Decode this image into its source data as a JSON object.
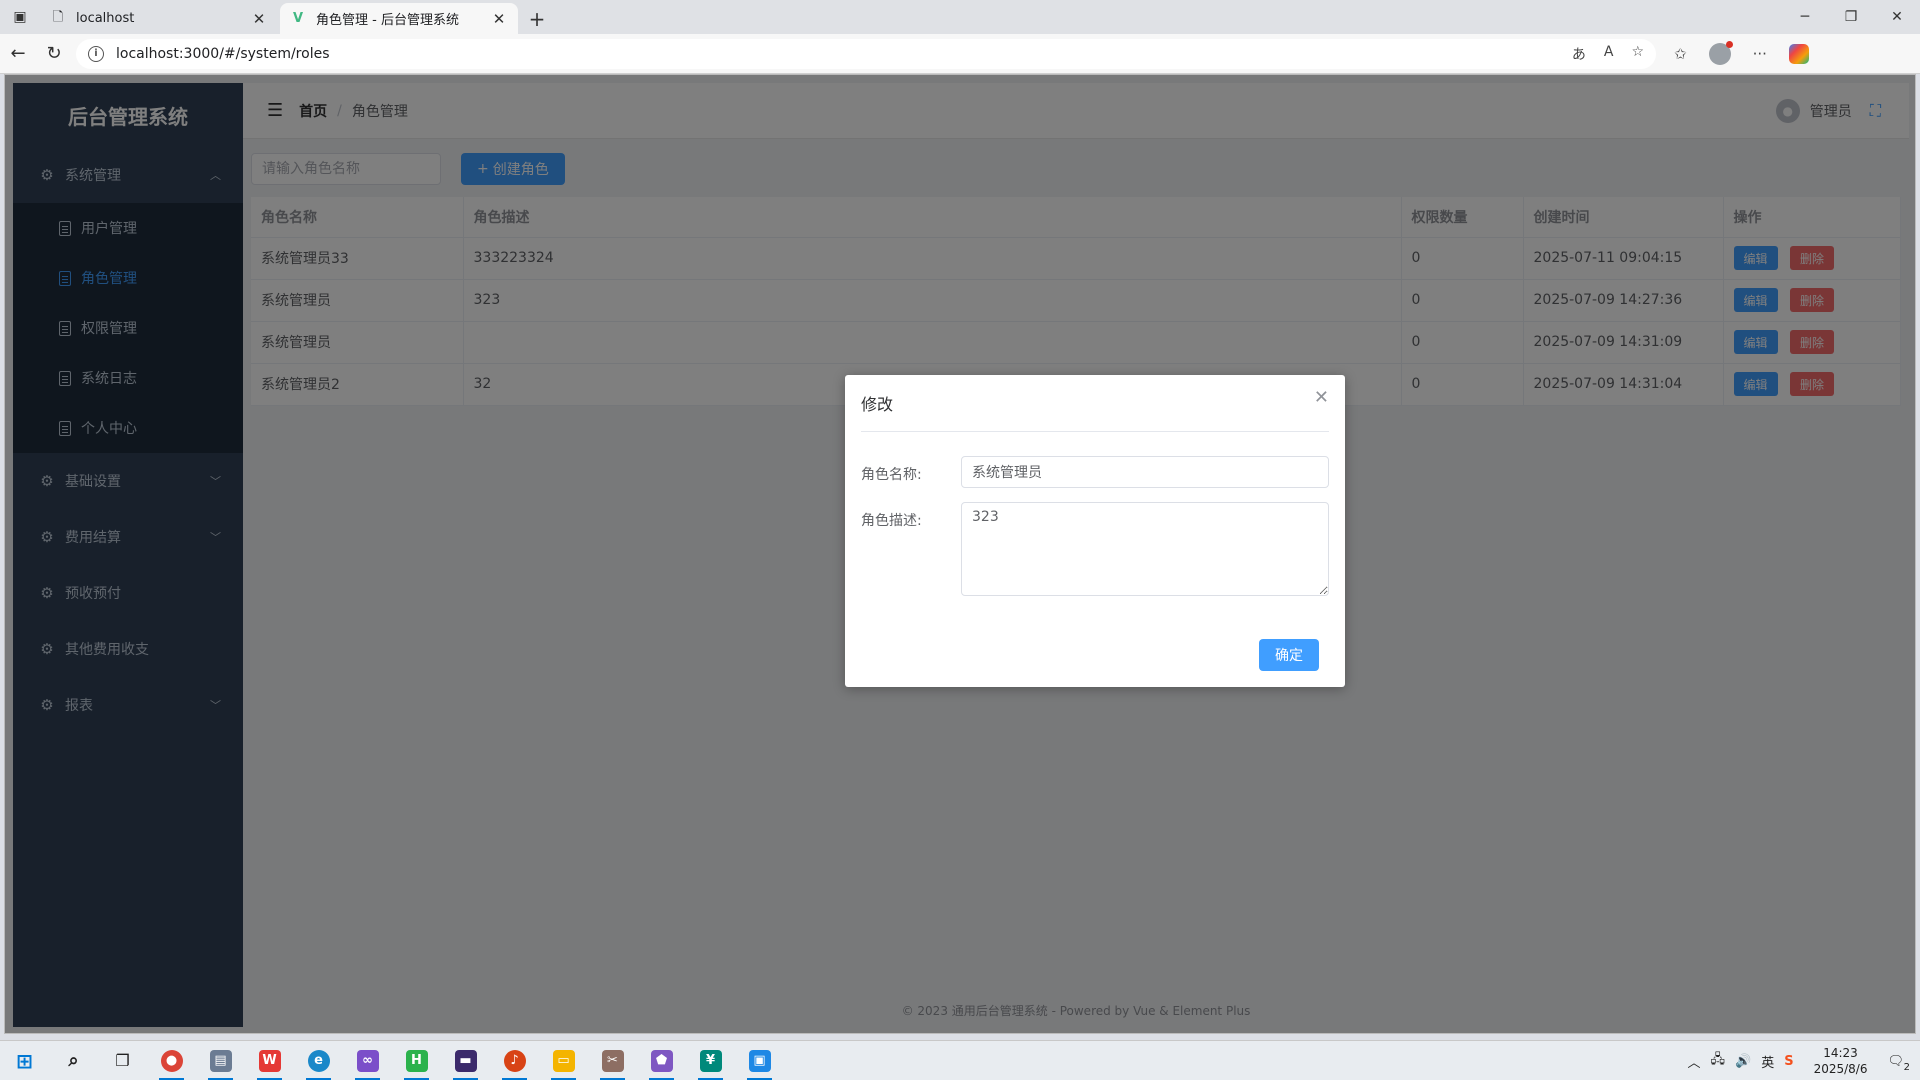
{
  "browser": {
    "tabs": [
      {
        "title": "localhost",
        "active": false
      },
      {
        "title": "角色管理 - 后台管理系统",
        "active": true
      }
    ],
    "url": "localhost:3000/#/system/roles"
  },
  "app": {
    "logo": "后台管理系统",
    "menu": [
      {
        "label": "系统管理",
        "expanded": true,
        "children": [
          {
            "label": "用户管理",
            "active": false
          },
          {
            "label": "角色管理",
            "active": true
          },
          {
            "label": "权限管理",
            "active": false
          },
          {
            "label": "系统日志",
            "active": false
          },
          {
            "label": "个人中心",
            "active": false
          }
        ]
      },
      {
        "label": "基础设置"
      },
      {
        "label": "费用结算"
      },
      {
        "label": "预收预付"
      },
      {
        "label": "其他费用收支"
      },
      {
        "label": "报表"
      }
    ],
    "breadcrumb": {
      "home": "首页",
      "separator": "/",
      "current": "角色管理"
    },
    "user": {
      "name": "管理员"
    }
  },
  "toolbar": {
    "search_placeholder": "请输入角色名称",
    "create_label": "创建角色"
  },
  "table": {
    "columns": [
      "角色名称",
      "角色描述",
      "权限数量",
      "创建时间",
      "操作"
    ],
    "rows": [
      {
        "name": "系统管理员33",
        "desc": "333223324",
        "perms": "0",
        "created": "2025-07-11 09:04:15"
      },
      {
        "name": "系统管理员",
        "desc": "323",
        "perms": "0",
        "created": "2025-07-09 14:27:36"
      },
      {
        "name": "系统管理员",
        "desc": "",
        "perms": "0",
        "created": "2025-07-09 14:31:09"
      },
      {
        "name": "系统管理员2",
        "desc": "32",
        "perms": "0",
        "created": "2025-07-09 14:31:04"
      }
    ],
    "edit_label": "编辑",
    "delete_label": "删除"
  },
  "footer": "© 2023 通用后台管理系统 - Powered by Vue & Element Plus",
  "dialog": {
    "title": "修改",
    "name_label": "角色名称:",
    "name_value": "系统管理员",
    "desc_label": "角色描述:",
    "desc_value": "323",
    "confirm_label": "确定"
  },
  "taskbar": {
    "time": "14:23",
    "date": "2025/8/6",
    "notifications": "2"
  },
  "colors": {
    "primary": "#409eff",
    "danger": "#f56c6c",
    "sidebar_bg": "#304156"
  }
}
